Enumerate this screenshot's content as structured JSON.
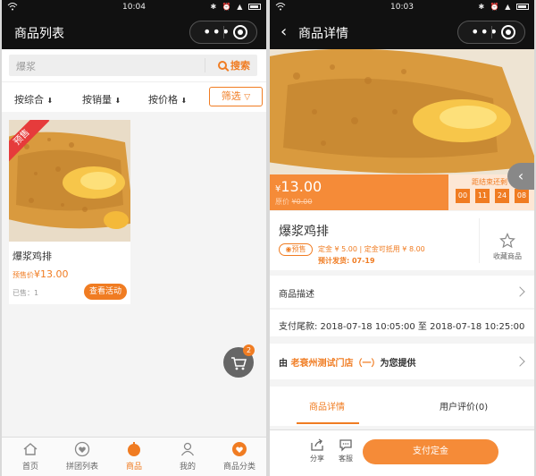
{
  "left": {
    "status": {
      "time": "10:04"
    },
    "nav": {
      "title": "商品列表",
      "dots": "•••"
    },
    "search": {
      "placeholder": "爆浆",
      "button": "搜索"
    },
    "sort": {
      "items": [
        "按综合",
        "按销量",
        "按价格"
      ],
      "arrow": "⬇",
      "filter": "筛选"
    },
    "product": {
      "ribbon": "预售",
      "name": "爆浆鸡排",
      "price_prefix": "预售价",
      "price": "¥13.00",
      "sold": "已售：1",
      "action": "查看活动"
    },
    "cart_badge": "2",
    "tabs": [
      {
        "label": "首页",
        "icon": "home-icon"
      },
      {
        "label": "拼团列表",
        "icon": "heart-icon"
      },
      {
        "label": "商品",
        "icon": "product-icon",
        "active": true
      },
      {
        "label": "我的",
        "icon": "person-icon"
      },
      {
        "label": "商品分类",
        "icon": "category-icon"
      }
    ],
    "colors": {
      "accent": "#f07c22",
      "ribbon": "#e63b3b"
    }
  },
  "right": {
    "status": {
      "time": "10:03"
    },
    "nav": {
      "back": "‹",
      "title": "商品详情",
      "dots": "•••"
    },
    "price": {
      "current": "13.00",
      "currency": "¥",
      "original": "¥0.00",
      "original_prefix": "原价"
    },
    "countdown": {
      "label": "距结束还剩",
      "values": [
        "00",
        "11",
        "24",
        "08"
      ]
    },
    "product": {
      "name": "爆浆鸡排",
      "tag": "预售",
      "deposit": "定金 ¥ 5.00  |  定金可抵用 ¥ 8.00",
      "ship": "预计发货:  07-19",
      "favorite": "收藏商品"
    },
    "desc": {
      "label": "商品描述"
    },
    "tail": {
      "text": "支付尾款:   2018-07-18 10:05:00 至 2018-07-18 10:25:00"
    },
    "store": {
      "prefix": "由 ",
      "name": "老衰州测试门店（一）",
      "suffix": "为您提供"
    },
    "tabs": {
      "detail": "商品详情",
      "reviews": "用户评价(0)"
    },
    "bottom": {
      "share": "分享",
      "service": "客服",
      "pay": "支付定金"
    }
  }
}
